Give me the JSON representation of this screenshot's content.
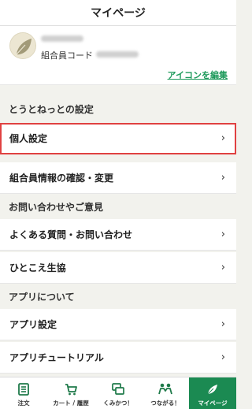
{
  "header": {
    "title": "マイページ"
  },
  "profile": {
    "member_code_label": "組合員コード",
    "edit_icon_link": "アイコンを編集"
  },
  "sections": {
    "toto": "とうとねっとの設定",
    "inquiry": "お問い合わせやご意見",
    "app": "アプリについて"
  },
  "rows": {
    "personal": "個人設定",
    "member_info": "組合員情報の確認・変更",
    "faq": "よくある質問・お問い合わせ",
    "hitokoe": "ひとこえ生協",
    "app_settings": "アプリ設定",
    "tutorial": "アプリチュートリアル"
  },
  "tabs": [
    {
      "label": "注文",
      "icon": "order-list-icon"
    },
    {
      "label": "カート / 履歴",
      "icon": "cart-icon"
    },
    {
      "label": "くみかつ！",
      "icon": "chat-icon"
    },
    {
      "label": "つながる！",
      "icon": "people-icon"
    },
    {
      "label": "マイページ",
      "icon": "mypage-icon"
    }
  ],
  "colors": {
    "accent": "#1b8a52",
    "link": "#1f9a5c",
    "highlight": "#e04141"
  }
}
